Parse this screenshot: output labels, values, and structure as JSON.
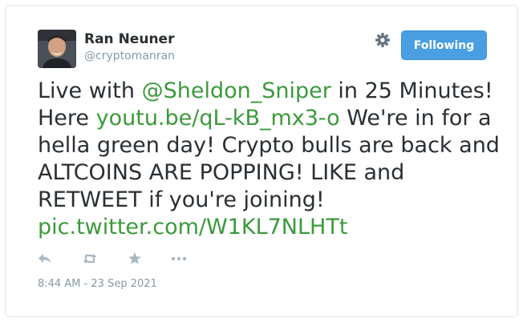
{
  "user": {
    "name": "Ran Neuner",
    "handle": "@cryptomanran"
  },
  "follow_button": {
    "label": "Following"
  },
  "tweet": {
    "segments": [
      {
        "text": "Live with ",
        "type": "text"
      },
      {
        "text": "@Sheldon_Sniper",
        "type": "link"
      },
      {
        "text": " in 25 Minutes! Here ",
        "type": "text"
      },
      {
        "text": "youtu.be/qL-kB_mx3-o",
        "type": "link"
      },
      {
        "text": " We're in for a hella green day! Crypto bulls are back and ALTCOINS ARE POPPING! LIKE and RETWEET if you're joining! ",
        "type": "text"
      },
      {
        "text": "pic.twitter.com/W1KL7NLHTt",
        "type": "link"
      }
    ],
    "timestamp": "8:44 AM - 23 Sep 2021"
  },
  "actions": [
    {
      "name": "reply-icon"
    },
    {
      "name": "retweet-icon"
    },
    {
      "name": "like-icon"
    },
    {
      "name": "more-icon"
    }
  ],
  "colors": {
    "link": "#3b9a3b",
    "follow_button": "#4a9fe3",
    "text": "#292f33",
    "muted": "#8899a6"
  }
}
